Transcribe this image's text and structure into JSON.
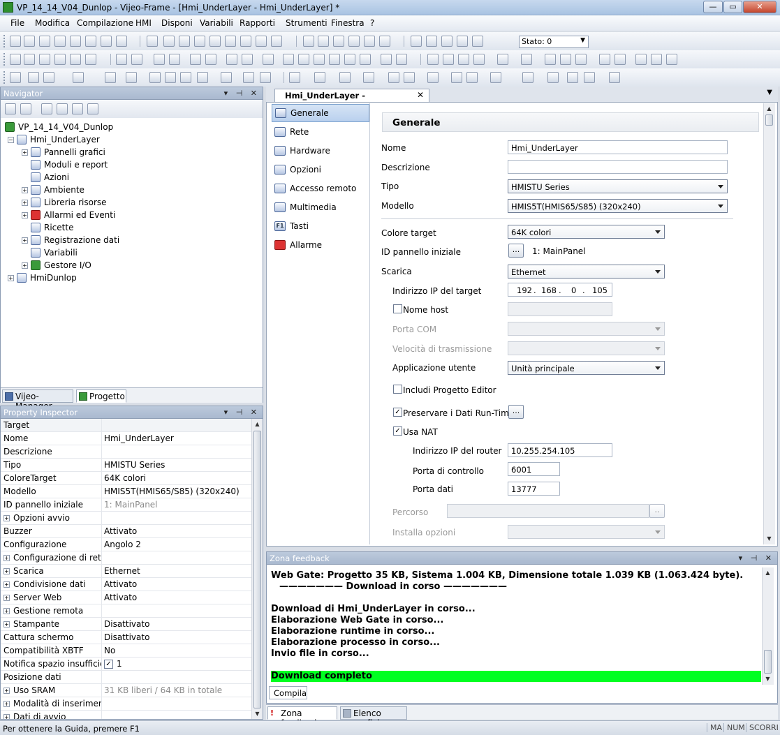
{
  "window": {
    "title": "VP_14_14_V04_Dunlop - Vijeo-Frame - [Hmi_UnderLayer - Hmi_UnderLayer] *"
  },
  "menu": [
    "File",
    "Modifica",
    "Compilazione",
    "HMI",
    "Disponi",
    "Variabili",
    "Rapporti",
    "Strumenti",
    "Finestra",
    "?"
  ],
  "toolbar": {
    "stato_label": "Stato:",
    "stato_value": "Stato: 0"
  },
  "navigator": {
    "title": "Navigator",
    "tree": [
      {
        "label": "VP_14_14_V04_Dunlop"
      },
      {
        "label": "Hmi_UnderLayer"
      },
      {
        "label": "Pannelli grafici"
      },
      {
        "label": "Moduli e report"
      },
      {
        "label": "Azioni"
      },
      {
        "label": "Ambiente"
      },
      {
        "label": "Libreria risorse"
      },
      {
        "label": "Allarmi ed Eventi"
      },
      {
        "label": "Ricette"
      },
      {
        "label": "Registrazione dati"
      },
      {
        "label": "Variabili"
      },
      {
        "label": "Gestore I/O"
      },
      {
        "label": "HmiDunlop"
      }
    ],
    "tabs": [
      "Vijeo-Manager",
      "Progetto"
    ]
  },
  "property_inspector": {
    "title": "Property Inspector",
    "header": "Target",
    "rows": [
      {
        "k": "Nome",
        "v": "Hmi_UnderLayer"
      },
      {
        "k": "Descrizione",
        "v": ""
      },
      {
        "k": "Tipo",
        "v": "HMISTU Series"
      },
      {
        "k": "ColoreTarget",
        "v": "64K colori"
      },
      {
        "k": "Modello",
        "v": "HMIS5T(HMIS65/S85) (320x240)"
      },
      {
        "k": "ID pannello iniziale",
        "v": "1: MainPanel"
      },
      {
        "k": "Opzioni avvio",
        "v": ""
      },
      {
        "k": "Buzzer",
        "v": "Attivato"
      },
      {
        "k": "Configurazione",
        "v": "Angolo 2"
      },
      {
        "k": "Configurazione di rete",
        "v": ""
      },
      {
        "k": "Scarica",
        "v": "Ethernet"
      },
      {
        "k": "Condivisione dati",
        "v": "Attivato"
      },
      {
        "k": "Server Web",
        "v": "Attivato"
      },
      {
        "k": "Gestione remota",
        "v": ""
      },
      {
        "k": "Stampante",
        "v": "Disattivato"
      },
      {
        "k": "Cattura schermo",
        "v": "Disattivato"
      },
      {
        "k": "Compatibilità XBTF",
        "v": "No"
      },
      {
        "k": "Notifica spazio insufficiente",
        "v": "1"
      },
      {
        "k": "Posizione dati",
        "v": ""
      },
      {
        "k": "Uso SRAM",
        "v": "31 KB liberi / 64 KB in totale"
      },
      {
        "k": "Modalità di inserimento",
        "v": ""
      },
      {
        "k": "Dati di avvio",
        "v": ""
      }
    ]
  },
  "editor": {
    "tab": "Hmi_UnderLayer - Hmi_UnderLayer",
    "side": [
      "Generale",
      "Rete",
      "Hardware",
      "Opzioni",
      "Accesso remoto",
      "Multimedia",
      "Tasti",
      "Allarme"
    ],
    "section": "Generale",
    "fields": {
      "nome_label": "Nome",
      "nome_value": "Hmi_UnderLayer",
      "descr_label": "Descrizione",
      "descr_value": "",
      "tipo_label": "Tipo",
      "tipo_value": "HMISTU Series",
      "modello_label": "Modello",
      "modello_value": "HMIS5T(HMIS65/S85) (320x240)",
      "colore_label": "Colore target",
      "colore_value": "64K colori",
      "idpan_label": "ID pannello iniziale",
      "idpan_btn": "...",
      "idpan_value": "1: MainPanel",
      "scarica_label": "Scarica",
      "scarica_value": "Ethernet",
      "ip_label": "Indirizzo IP del target",
      "ip1": "192",
      "ip2": "168",
      "ip3": "0",
      "ip4": "105",
      "host_label": "Nome host",
      "com_label": "Porta COM",
      "vel_label": "Velocità di trasmissione",
      "app_label": "Applicazione utente",
      "app_value": "Unità principale",
      "incl_label": "Includi Progetto Editor",
      "pres_label": "Preservare i Dati Run-Time",
      "pres_btn": "...",
      "nat_label": "Usa NAT",
      "router_label": "Indirizzo IP del router",
      "router_value": "10.255.254.105",
      "ctrl_label": "Porta di controllo",
      "ctrl_value": "6001",
      "dati_label": "Porta dati",
      "dati_value": "13777",
      "perc_label": "Percorso",
      "perc_btn": "..",
      "inst_label": "Installa opzioni"
    }
  },
  "feedback": {
    "title": "Zona feedback",
    "lines": [
      "Web Gate: Progetto 35 KB, Sistema 1.004 KB, Dimensione totale 1.039 KB (1.063.424 byte).",
      "——————— Download in corso ———————",
      "",
      "Download di Hmi_UnderLayer in corso...",
      "Elaborazione Web Gate in corso...",
      "Elaborazione runtime in corso...",
      "Elaborazione processo in corso...",
      "Invio file in corso...",
      "",
      "Download completo"
    ],
    "tab": "Compila",
    "bottom_tabs": [
      "Zona feedback",
      "Elenco grafici"
    ]
  },
  "status": {
    "text": "Per ottenere la Guida, premere F1",
    "ind": [
      "MA",
      "NUM",
      "SCORRI"
    ]
  }
}
